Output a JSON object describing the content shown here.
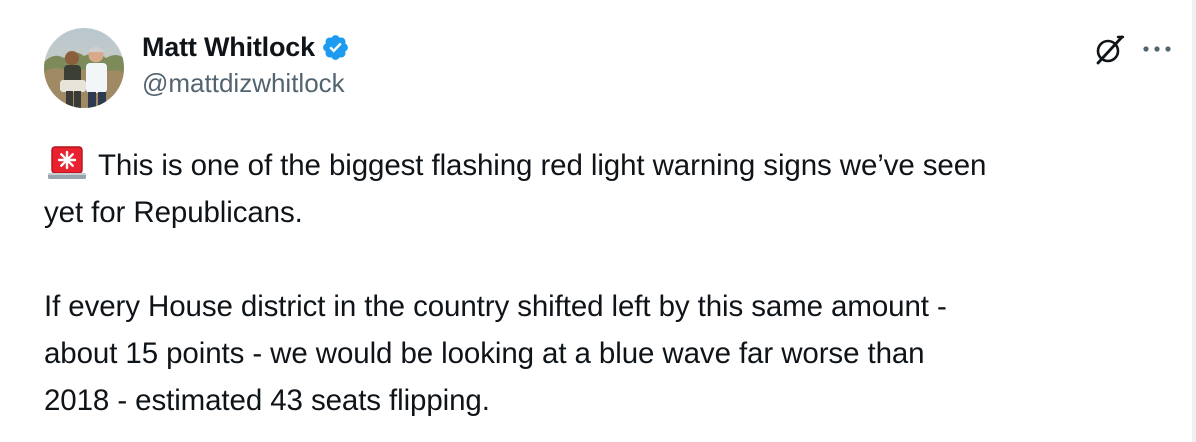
{
  "author": {
    "display_name": "Matt Whitlock",
    "handle": "@mattdizwhitlock",
    "verified": true,
    "avatar_icon": "avatar-photo",
    "verified_color": "#1d9bf0"
  },
  "header_actions": {
    "grok_icon": "grok-icon",
    "more_icon": "more-icon"
  },
  "tweet": {
    "emoji": "siren-emoji",
    "line1": "This is one of the biggest flashing red light warning signs we’ve seen",
    "line2": "yet for Republicans.",
    "line3": "If every House district in the country shifted left by this same amount -",
    "line4": "about 15 points - we would be looking at a blue wave far worse than",
    "line5": "2018 - estimated 43 seats flipping."
  },
  "colors": {
    "text": "#0f1419",
    "secondary": "#536471",
    "siren_red": "#e8222f"
  }
}
